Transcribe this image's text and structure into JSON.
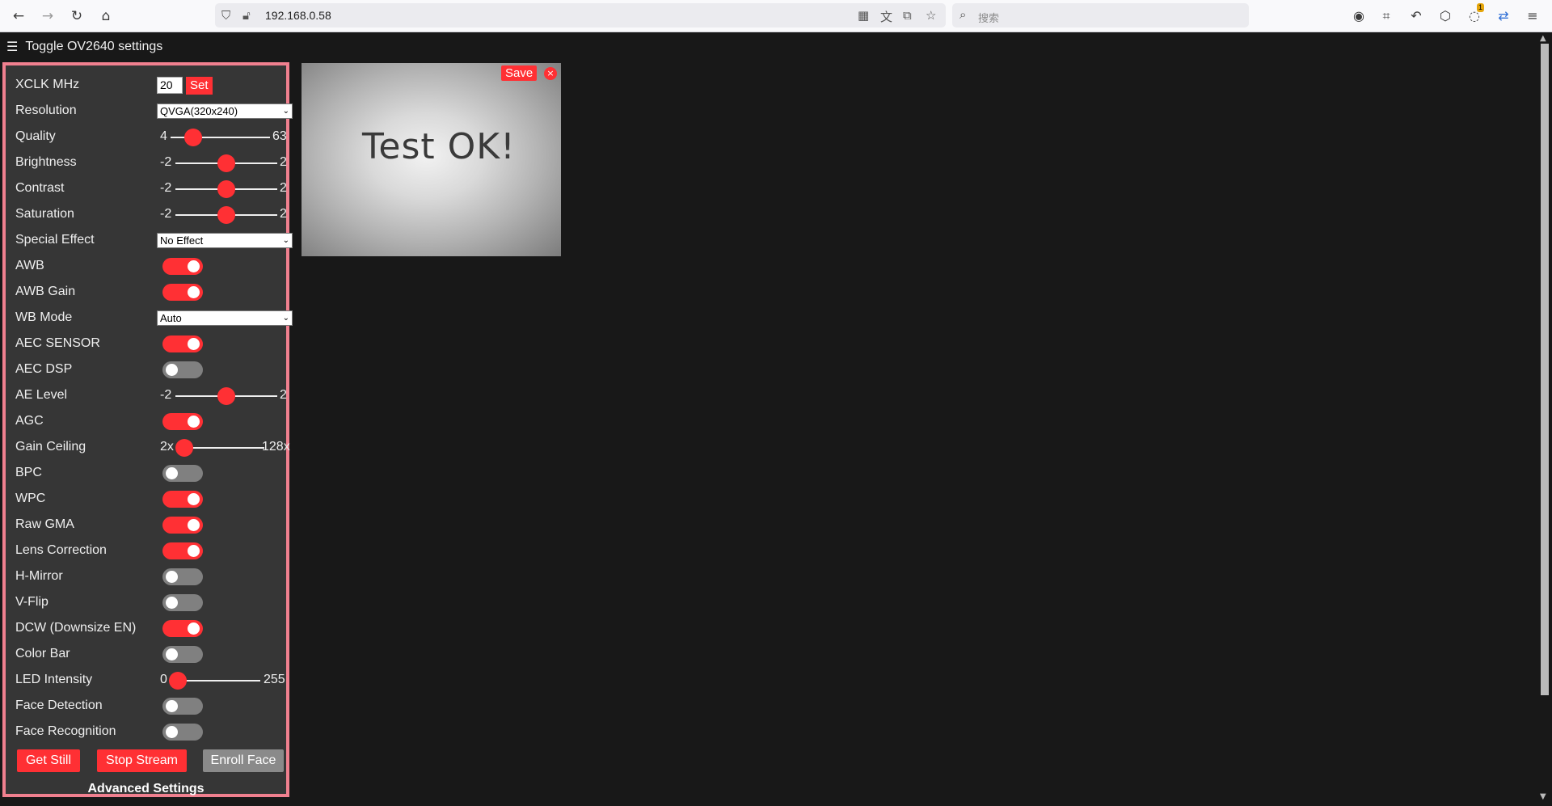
{
  "browser": {
    "url": "192.168.0.58",
    "search_placeholder": "搜索",
    "notification_count": "1"
  },
  "page": {
    "toggle_label": "Toggle OV2640 settings"
  },
  "settings": {
    "xclk": {
      "label": "XCLK MHz",
      "value": "20",
      "button": "Set"
    },
    "resolution": {
      "label": "Resolution",
      "value": "QVGA(320x240)"
    },
    "quality": {
      "label": "Quality",
      "min": "4",
      "max": "63",
      "value": 10
    },
    "brightness": {
      "label": "Brightness",
      "min": "-2",
      "max": "2",
      "value": 0
    },
    "contrast": {
      "label": "Contrast",
      "min": "-2",
      "max": "2",
      "value": 0
    },
    "saturation": {
      "label": "Saturation",
      "min": "-2",
      "max": "2",
      "value": 0
    },
    "special_effect": {
      "label": "Special Effect",
      "value": "No Effect"
    },
    "awb": {
      "label": "AWB",
      "on": true
    },
    "awb_gain": {
      "label": "AWB Gain",
      "on": true
    },
    "wb_mode": {
      "label": "WB Mode",
      "value": "Auto"
    },
    "aec_sensor": {
      "label": "AEC SENSOR",
      "on": true
    },
    "aec_dsp": {
      "label": "AEC DSP",
      "on": false
    },
    "ae_level": {
      "label": "AE Level",
      "min": "-2",
      "max": "2",
      "value": 0
    },
    "agc": {
      "label": "AGC",
      "on": true
    },
    "gain_ceiling": {
      "label": "Gain Ceiling",
      "min": "2x",
      "max": "128x",
      "value": 0
    },
    "bpc": {
      "label": "BPC",
      "on": false
    },
    "wpc": {
      "label": "WPC",
      "on": true
    },
    "raw_gma": {
      "label": "Raw GMA",
      "on": true
    },
    "lens_correction": {
      "label": "Lens Correction",
      "on": true
    },
    "h_mirror": {
      "label": "H-Mirror",
      "on": false
    },
    "v_flip": {
      "label": "V-Flip",
      "on": false
    },
    "dcw": {
      "label": "DCW (Downsize EN)",
      "on": true
    },
    "color_bar": {
      "label": "Color Bar",
      "on": false
    },
    "led_intensity": {
      "label": "LED Intensity",
      "min": "0",
      "max": "255",
      "value": 0
    },
    "face_detection": {
      "label": "Face Detection",
      "on": false
    },
    "face_recognition": {
      "label": "Face Recognition",
      "on": false
    }
  },
  "buttons": {
    "get_still": "Get Still",
    "stop_stream": "Stop Stream",
    "enroll_face": "Enroll Face"
  },
  "advanced_label": "Advanced Settings",
  "stream": {
    "text": "Test OK!",
    "save": "Save",
    "close": "×"
  },
  "colors": {
    "accent": "#ff3034",
    "panel": "#363636",
    "border": "#f0808f",
    "background": "#181818"
  }
}
